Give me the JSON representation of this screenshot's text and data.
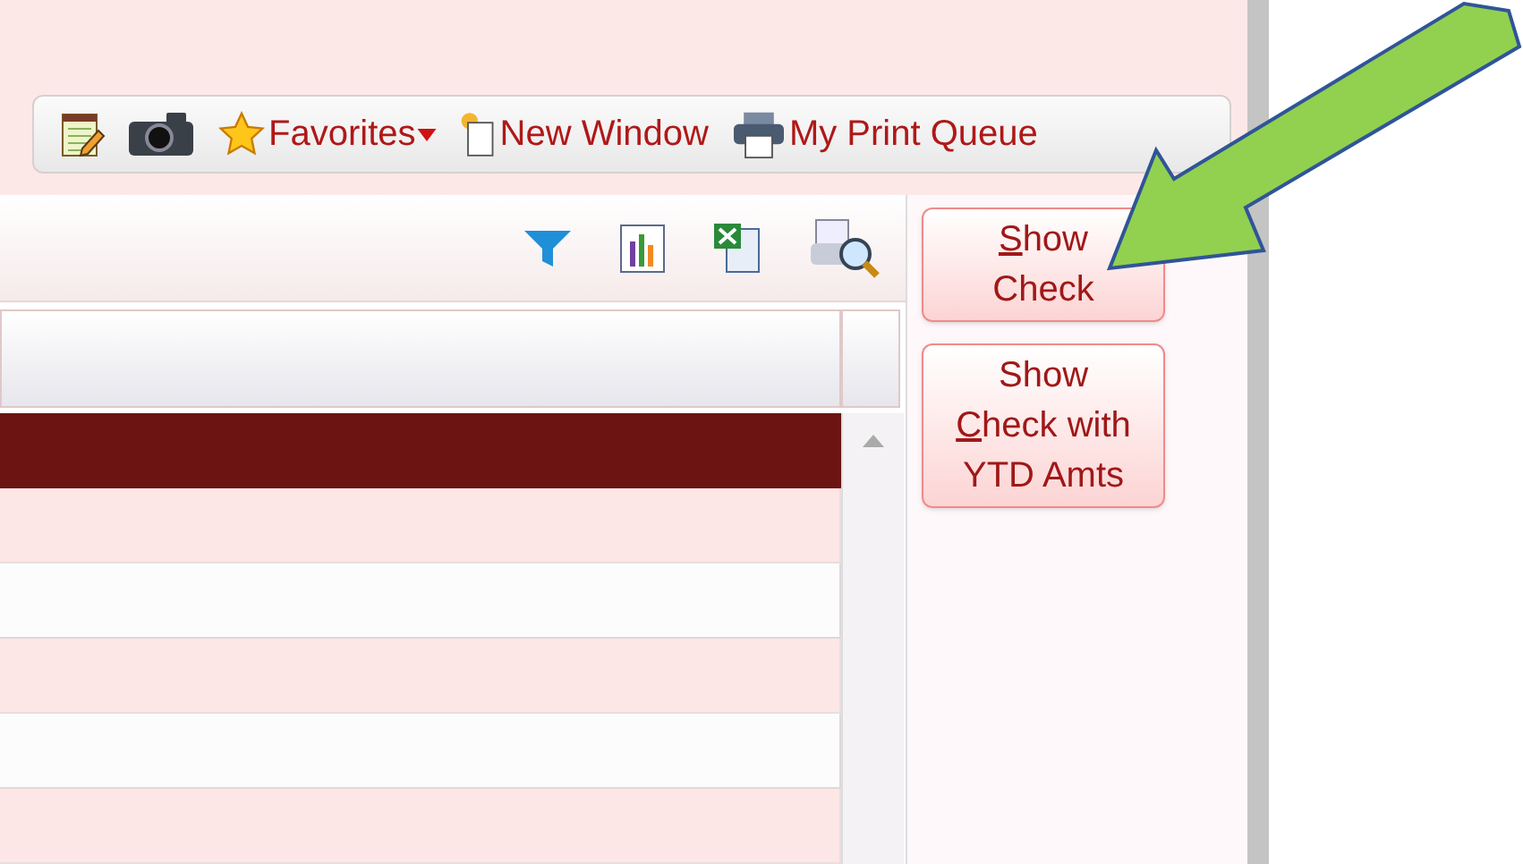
{
  "toolbar": {
    "items": [
      {
        "kind": "notes",
        "dropdown": false
      },
      {
        "kind": "camera",
        "dropdown": false
      },
      {
        "kind": "favorites",
        "label": "Favorites",
        "dropdown": true
      },
      {
        "kind": "new-window",
        "label": "New Window",
        "dropdown": false
      },
      {
        "kind": "print",
        "label": "My Print Queue",
        "dropdown": false
      }
    ]
  },
  "grid_toolbar": {
    "tools": [
      {
        "kind": "filter"
      },
      {
        "kind": "chart"
      },
      {
        "kind": "excel"
      },
      {
        "kind": "preview"
      }
    ]
  },
  "grid": {
    "rows": [
      {
        "selected": true
      },
      {
        "selected": false
      },
      {
        "selected": false
      },
      {
        "selected": false
      },
      {
        "selected": false
      },
      {
        "selected": false
      }
    ]
  },
  "actions": [
    {
      "lines": [
        [
          {
            "text": "S",
            "underlined": true
          },
          {
            "text": "how",
            "underlined": false
          }
        ],
        [
          {
            "text": "Check",
            "underlined": false
          }
        ]
      ]
    },
    {
      "lines": [
        [
          {
            "text": "Show",
            "underlined": false
          }
        ],
        [
          {
            "text": "C",
            "underlined": true
          },
          {
            "text": "heck with",
            "underlined": false
          }
        ],
        [
          {
            "text": "YTD Amts",
            "underlined": false
          }
        ]
      ]
    }
  ],
  "annotation": {
    "kind": "arrow"
  }
}
